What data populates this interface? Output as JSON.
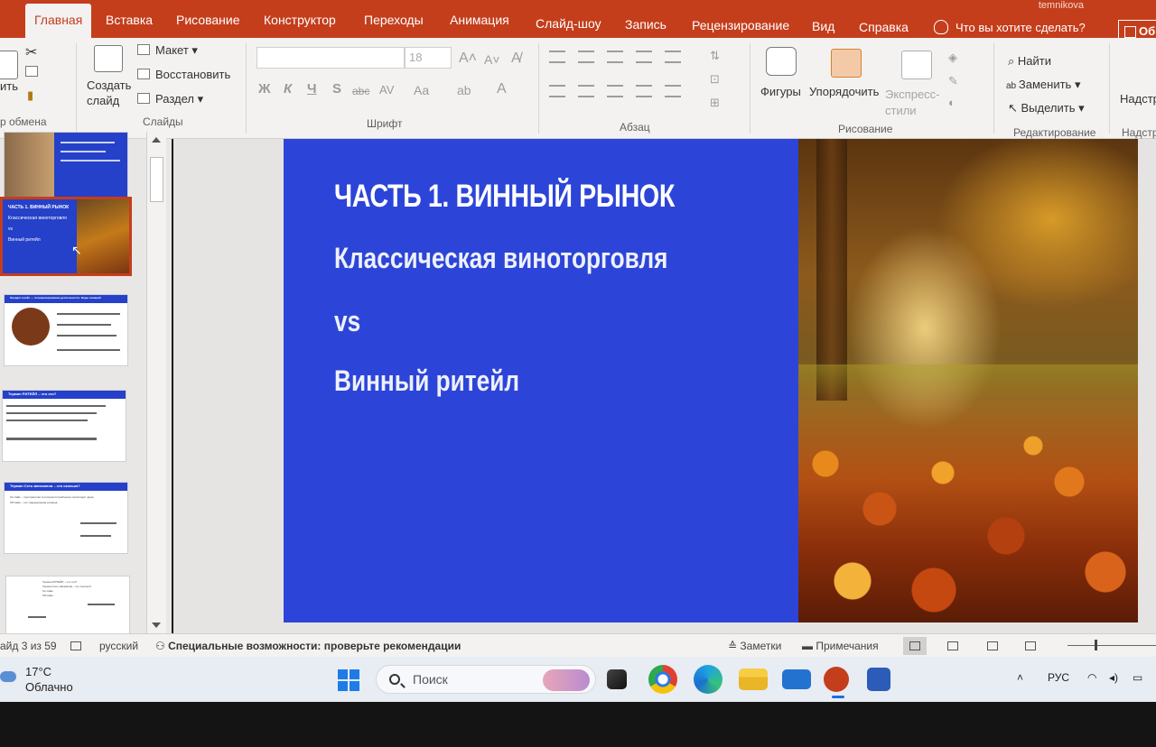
{
  "ribbon_tabs": [
    {
      "label": "Главная",
      "active": true
    },
    {
      "label": "Вставка"
    },
    {
      "label": "Рисование"
    },
    {
      "label": "Конструктор"
    },
    {
      "label": "Переходы"
    },
    {
      "label": "Анимация"
    },
    {
      "label": "Слайд-шоу"
    },
    {
      "label": "Запись"
    },
    {
      "label": "Рецензирование"
    },
    {
      "label": "Вид"
    },
    {
      "label": "Справка"
    }
  ],
  "user_name": "temnikova",
  "tell_me": "Что вы хотите сделать?",
  "share_label": "Об",
  "ribbon": {
    "clipboard": {
      "paste_label": "ить",
      "group": "р обмена"
    },
    "slides": {
      "new_slide": "Создать слайд",
      "layout": "Макет",
      "reset": "Восстановить",
      "section": "Раздел",
      "group": "Слайды"
    },
    "font": {
      "size": "18",
      "group": "Шрифт",
      "bold": "Ж",
      "italic": "К",
      "underline": "Ч",
      "shadow": "S",
      "strike": "abc",
      "spacing": "AV",
      "case": "Aa"
    },
    "paragraph": {
      "group": "Абзац"
    },
    "drawing": {
      "shapes": "Фигуры",
      "arrange": "Упорядочить",
      "quick_styles": "Экспресс-стили",
      "group": "Рисование"
    },
    "editing": {
      "find": "Найти",
      "replace": "Заменить",
      "select": "Выделить",
      "group": "Редактирование"
    },
    "addins": {
      "label": "Надстр",
      "group": "Надстр"
    }
  },
  "slide": {
    "title": "ЧАСТЬ 1. ВИННЫЙ РЫНОК",
    "line1": "Классическая виноторговля",
    "line2": "vs",
    "line3": "Винный ритейл"
  },
  "thumbnails": {
    "slide3_title": "ЧАСТЬ 1. ВИННЫЙ РЫНОК",
    "slide3_sub": "Классическая виноторговля",
    "slide3_vs": "vs",
    "slide3_retail": "Винный ритейл",
    "slide4_title": "Продакт-плейс — позиционирование деятельности. Виды  винарий",
    "slide5_title": "Термин РИТЕЙЛ – что это?",
    "slide6_title": "Термин Сеть магазинов – это сколько?",
    "slide6_line1": "On-trade – пространство в котором потребление происходит здесь",
    "slide6_line2": "Off-trade – это традиционная розница",
    "slide7_line1": "Термин РИТЕЙЛ – что это?",
    "slide7_line2": "Термин Сеть магазинов – это сколько?",
    "slide7_line3": "On-trade",
    "slide7_line4": "Off-trade"
  },
  "status": {
    "slide_counter": "айд 3 из 59",
    "language": "русский",
    "accessibility": "Специальные возможности: проверьте рекомендации",
    "notes": "Заметки",
    "comments": "Примечания"
  },
  "taskbar": {
    "temperature": "17°C",
    "weather": "Облачно",
    "search_placeholder": "Поиск",
    "lang": "РУС"
  },
  "colors": {
    "accent": "#c43e1c",
    "slide_blue": "#2c45d8"
  }
}
